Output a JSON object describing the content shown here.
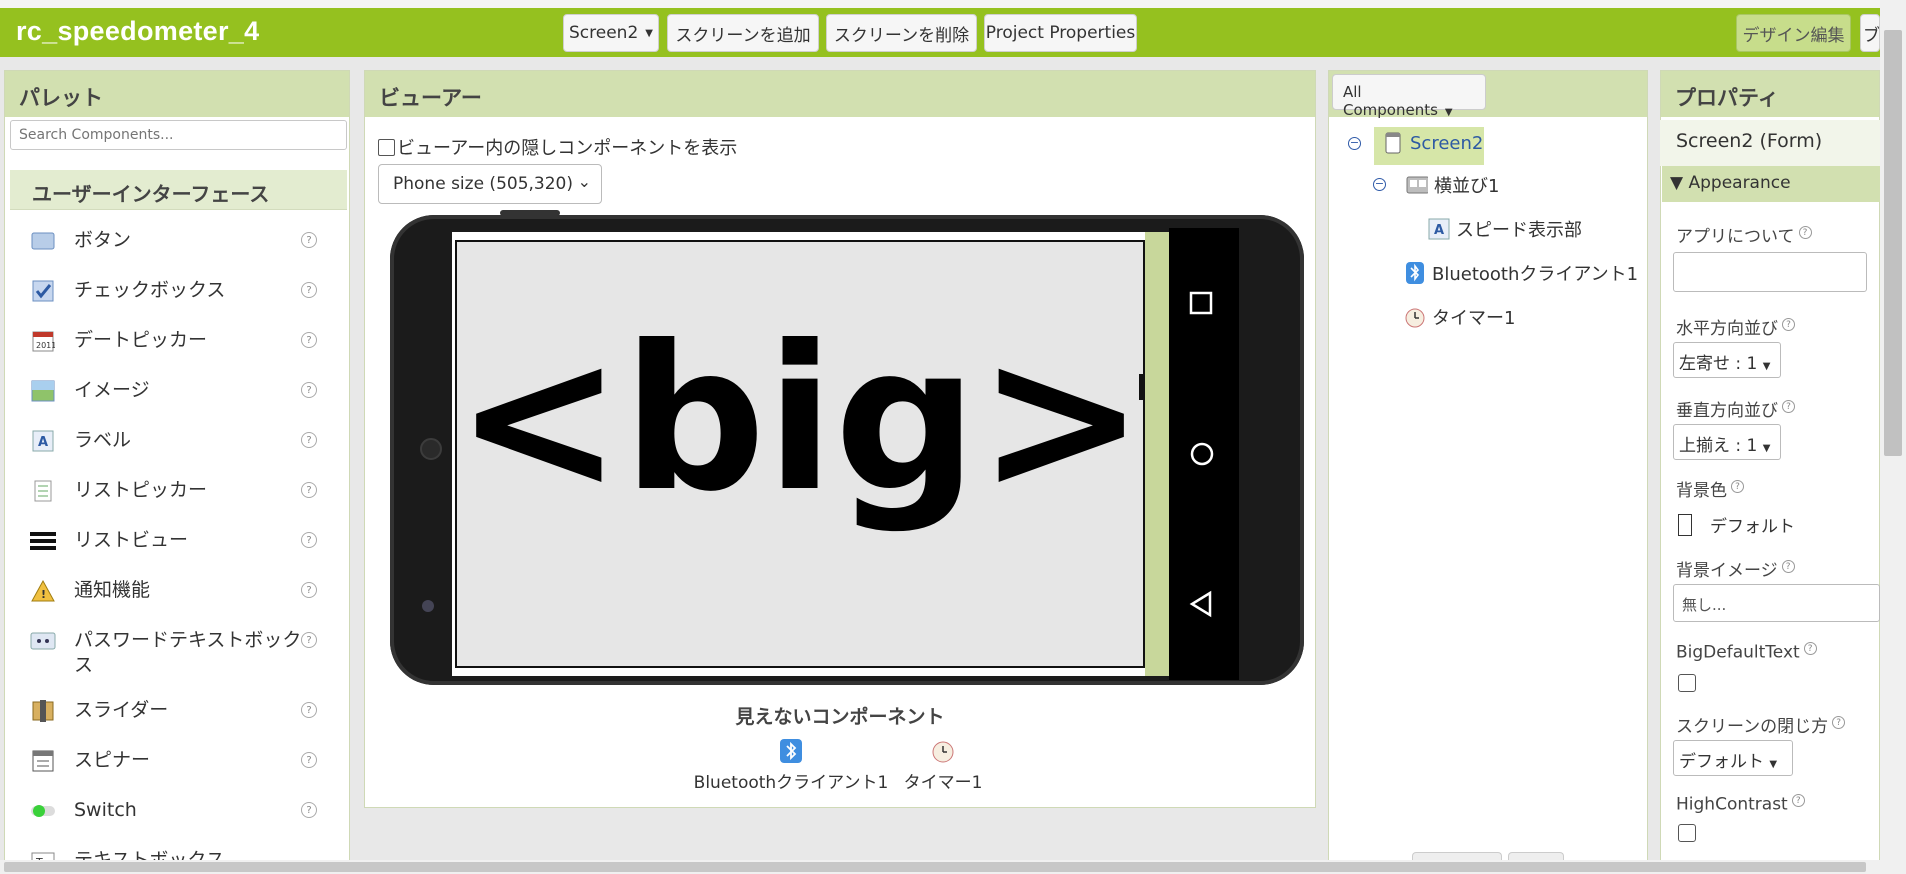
{
  "app": {
    "title": "rc_speedometer_4"
  },
  "toolbar": {
    "screen_select": "Screen2",
    "add_screen": "スクリーンを追加",
    "remove_screen": "スクリーンを削除",
    "project_properties": "Project Properties",
    "design_edit": "デザイン編集",
    "blocks_partial": "ブ"
  },
  "palette": {
    "title": "パレット",
    "search_placeholder": "Search Components...",
    "category": "ユーザーインターフェース",
    "items": [
      {
        "label": "ボタン",
        "icon": "button-icon"
      },
      {
        "label": "チェックボックス",
        "icon": "checkbox-icon"
      },
      {
        "label": "デートピッカー",
        "icon": "datepicker-icon"
      },
      {
        "label": "イメージ",
        "icon": "image-icon"
      },
      {
        "label": "ラベル",
        "icon": "label-icon"
      },
      {
        "label": "リストピッカー",
        "icon": "listpicker-icon"
      },
      {
        "label": "リストビュー",
        "icon": "listview-icon"
      },
      {
        "label": "通知機能",
        "icon": "notifier-icon"
      },
      {
        "label": "パスワードテキストボックス",
        "icon": "password-icon"
      },
      {
        "label": "スライダー",
        "icon": "slider-icon"
      },
      {
        "label": "スピナー",
        "icon": "spinner-icon"
      },
      {
        "label": "Switch",
        "icon": "switch-icon"
      },
      {
        "label": "テキストボックス",
        "icon": "textbox-icon"
      }
    ],
    "help_glyph": "?"
  },
  "viewer": {
    "title": "ビューアー",
    "show_hidden_label": "ビューアー内の隠しコンポーネントを表示",
    "size_select": "Phone size (505,320)",
    "screen_text": "<big>",
    "nonvisible_title": "見えないコンポーネント",
    "nonvisible": [
      {
        "label": "Bluetoothクライアント1",
        "icon": "bluetooth-icon"
      },
      {
        "label": "タイマー1",
        "icon": "clock-icon"
      }
    ]
  },
  "components": {
    "dropdown": "All Components",
    "tree": [
      {
        "label": "Screen2",
        "icon": "screen-icon",
        "selected": true
      },
      {
        "label": "横並び1",
        "icon": "horizontal-arrangement-icon"
      },
      {
        "label": "スピード表示部",
        "icon": "label-icon"
      },
      {
        "label": "Bluetoothクライアント1",
        "icon": "bluetooth-icon"
      },
      {
        "label": "タイマー1",
        "icon": "clock-icon"
      }
    ]
  },
  "properties": {
    "title": "プロパティ",
    "component": "Screen2 (Form)",
    "group": "Appearance",
    "about": "アプリについて",
    "align_h": "水平方向並び",
    "align_h_value": "左寄せ : 1",
    "align_v": "垂直方向並び",
    "align_v_value": "上揃え : 1",
    "bg_color": "背景色",
    "bg_color_value": "デフォルト",
    "bg_image": "背景イメージ",
    "bg_image_value": "無し...",
    "big_default_text": "BigDefaultText",
    "close_anim": "スクリーンの閉じ方",
    "close_anim_value": "デフォルト",
    "high_contrast": "HighContrast"
  },
  "colors": {
    "accent": "#95c11f",
    "header": "#d2e0b0"
  }
}
